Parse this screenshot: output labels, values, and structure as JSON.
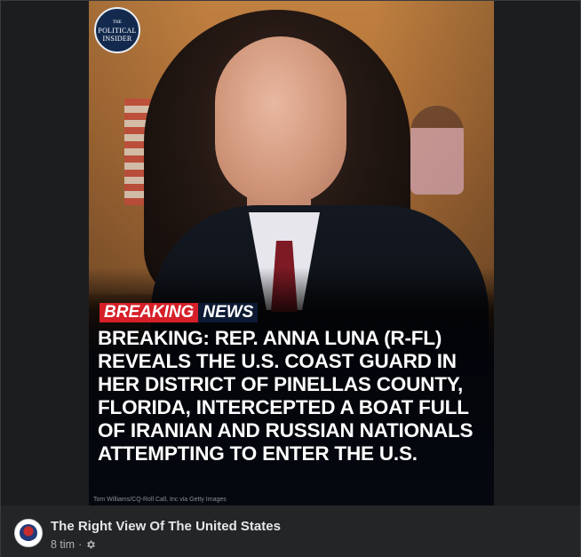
{
  "post_image": {
    "logo_text_line1": "POLITICAL",
    "logo_text_line2": "INSIDER",
    "logo_prefix": "THE",
    "tag_breaking": "BREAKING",
    "tag_news": "NEWS",
    "headline": "BREAKING: REP. ANNA LUNA (R-FL) REVEALS THE U.S. COAST GUARD IN HER DISTRICT OF PINELLAS COUNTY, FLORIDA, INTERCEPTED A BOAT FULL OF IRANIAN AND RUSSIAN NATIONALS ATTEMPTING TO ENTER THE U.S.",
    "credit": "Tom Williams/CQ-Roll Call, Inc via Getty Images"
  },
  "author": {
    "page_name": "The Right View Of The United States",
    "time": "8 tim",
    "separator": "·",
    "privacy_icon": "gear-icon"
  },
  "colors": {
    "breaking_red": "#d61f28",
    "news_navy": "#0d1a33",
    "bar_background": "#242526"
  }
}
